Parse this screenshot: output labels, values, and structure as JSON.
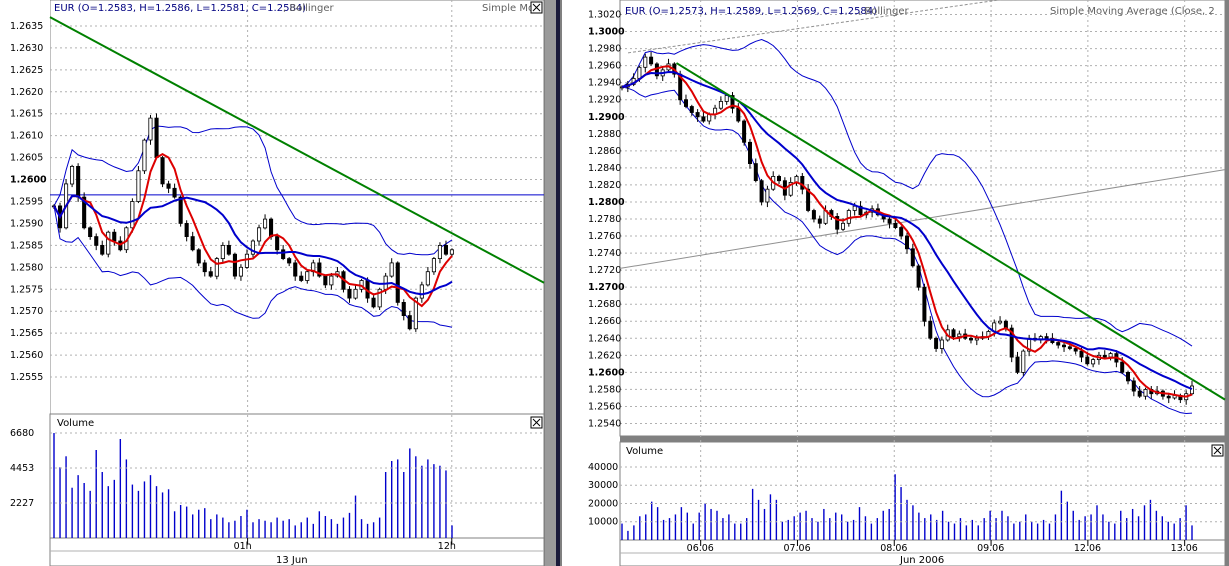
{
  "colors": {
    "candle": "#000000",
    "bollinger": "#0000cc",
    "sma_red": "#dd0000",
    "sma_blue": "#0000cc",
    "trendline": "#008000",
    "volume": "#0000cc",
    "grid": "#b0b0b0",
    "panel_bg": "#ffffff",
    "frame_bg": "#808080"
  },
  "left": {
    "header": "EUR (O=1.2583, H=1.2586, L=1.2581, C=1.2584)",
    "indicator_label": ", Bollinger",
    "right_label": "Simple Mo",
    "volume_label": "Volume",
    "x_ticks": [
      {
        "label": "01h",
        "x": 60
      },
      {
        "label": "12h",
        "x": 122
      }
    ],
    "date_label": "13 Jun"
  },
  "right": {
    "header": "EUR (O=1.2573, H=1.2589, L=1.2569, C=1.2584)",
    "indicator_label": ", Bollinger",
    "right_label": "Simple Moving Average (Close, 2",
    "volume_label": "Volume",
    "x_ticks": [
      {
        "label": "06.06",
        "x": 20
      },
      {
        "label": "07.06",
        "x": 44
      },
      {
        "label": "08.06",
        "x": 68
      },
      {
        "label": "09.06",
        "x": 92
      },
      {
        "label": "12.06",
        "x": 116
      },
      {
        "label": "13.06",
        "x": 140
      }
    ],
    "date_label": "Jun 2006"
  },
  "chart_data": [
    {
      "type": "candlestick",
      "title": "EUR (O=1.2583, H=1.2586, L=1.2581, C=1.2584)",
      "ylim": [
        1.255,
        1.264
      ],
      "y_ticks": [
        "1.2555",
        "1.2560",
        "1.2565",
        "1.2570",
        "1.2575",
        "1.2580",
        "1.2585",
        "1.2590",
        "1.2595",
        "1.2600",
        "1.2605",
        "1.2610",
        "1.2615",
        "1.2620",
        "1.2625",
        "1.2630",
        "1.2635"
      ],
      "bold_ticks": [
        "1.2600"
      ],
      "xlim": [
        0,
        150
      ],
      "horizontal_line": 1.25965,
      "trendline": {
        "x": [
          0,
          150
        ],
        "y": [
          1.2637,
          1.25765
        ]
      },
      "close": [
        1.2594,
        1.2589,
        1.2599,
        1.2603,
        1.2596,
        1.2589,
        1.2587,
        1.2585,
        1.2583,
        1.2588,
        1.2586,
        1.2584,
        1.2589,
        1.2595,
        1.2602,
        1.2609,
        1.2614,
        1.2605,
        1.2599,
        1.2598,
        1.2596,
        1.259,
        1.2587,
        1.2584,
        1.2581,
        1.2579,
        1.2578,
        1.2582,
        1.2585,
        1.2583,
        1.2578,
        1.258,
        1.2583,
        1.2586,
        1.2589,
        1.2591,
        1.2587,
        1.2584,
        1.2582,
        1.2581,
        1.2578,
        1.2577,
        1.2579,
        1.2581,
        1.2578,
        1.2576,
        1.2578,
        1.2579,
        1.2575,
        1.2573,
        1.2575,
        1.2577,
        1.2573,
        1.2571,
        1.2575,
        1.2578,
        1.2581,
        1.2572,
        1.2569,
        1.2566,
        1.2573,
        1.2576,
        1.2579,
        1.2582,
        1.2585,
        1.2583,
        1.2584
      ],
      "volume": {
        "ylim": [
          0,
          7000
        ],
        "y_ticks": [
          "2227",
          "4453",
          "6680"
        ],
        "values": [
          6680,
          4500,
          5200,
          3200,
          4000,
          3500,
          3000,
          5600,
          4200,
          3300,
          3700,
          6300,
          5000,
          3400,
          3000,
          3600,
          4000,
          3300,
          2900,
          3100,
          1700,
          2100,
          2000,
          1500,
          1800,
          1900,
          1200,
          1500,
          1300,
          1000,
          1100,
          1400,
          1800,
          1000,
          1200,
          1100,
          1000,
          1300,
          1100,
          1200,
          800,
          1000,
          1300,
          900,
          1700,
          1400,
          1200,
          900,
          1300,
          1600,
          2700,
          1200,
          900,
          1000,
          1300,
          4200,
          4900,
          5000,
          4200,
          5700,
          5200,
          4600,
          5000,
          4700,
          4600,
          4300,
          800
        ]
      }
    },
    {
      "type": "candlestick",
      "title": "EUR (O=1.2573, H=1.2589, L=1.2569, C=1.2584)",
      "ylim": [
        1.253,
        1.303
      ],
      "y_ticks": [
        "1.2540",
        "1.2560",
        "1.2580",
        "1.2600",
        "1.2620",
        "1.2640",
        "1.2660",
        "1.2680",
        "1.2700",
        "1.2720",
        "1.2740",
        "1.2760",
        "1.2780",
        "1.2800",
        "1.2820",
        "1.2840",
        "1.2860",
        "1.2880",
        "1.2900",
        "1.2920",
        "1.2940",
        "1.2960",
        "1.2980",
        "1.3000",
        "1.3020"
      ],
      "bold_ticks": [
        "1.2600",
        "1.2700",
        "1.2800",
        "1.2900",
        "1.3000"
      ],
      "xlim": [
        0,
        150
      ],
      "trendline": {
        "x": [
          14,
          150
        ],
        "y": [
          1.2963,
          1.2568
        ]
      },
      "channel_upper": {
        "x": [
          2,
          150
        ],
        "y": [
          1.2975,
          1.3075
        ]
      },
      "channel_lower": {
        "x": [
          0,
          150
        ],
        "y": [
          1.2722,
          1.2838
        ]
      },
      "close": [
        1.2935,
        1.2938,
        1.2945,
        1.2958,
        1.297,
        1.2962,
        1.2948,
        1.2955,
        1.2962,
        1.295,
        1.292,
        1.2912,
        1.2905,
        1.29,
        1.2895,
        1.2903,
        1.291,
        1.2918,
        1.2925,
        1.291,
        1.2895,
        1.287,
        1.2845,
        1.2825,
        1.28,
        1.2815,
        1.283,
        1.2825,
        1.2808,
        1.2823,
        1.283,
        1.2815,
        1.279,
        1.278,
        1.2775,
        1.279,
        1.2783,
        1.2768,
        1.2775,
        1.279,
        1.2795,
        1.2785,
        1.2788,
        1.2792,
        1.2785,
        1.278,
        1.2775,
        1.277,
        1.276,
        1.2745,
        1.2725,
        1.27,
        1.266,
        1.264,
        1.2628,
        1.2638,
        1.265,
        1.2642,
        1.2645,
        1.264,
        1.2638,
        1.264,
        1.2642,
        1.2648,
        1.2658,
        1.266,
        1.2652,
        1.2618,
        1.26,
        1.2625,
        1.264,
        1.2638,
        1.2642,
        1.264,
        1.2635,
        1.2632,
        1.263,
        1.2628,
        1.2625,
        1.2618,
        1.261,
        1.2615,
        1.262,
        1.2618,
        1.2622,
        1.2612,
        1.26,
        1.259,
        1.2578,
        1.2572,
        1.258,
        1.2575,
        1.2578,
        1.2572,
        1.257,
        1.2573,
        1.2568,
        1.2575,
        1.2584
      ],
      "volume": {
        "ylim": [
          0,
          46000
        ],
        "y_ticks": [
          "10000",
          "20000",
          "30000",
          "40000"
        ],
        "values": [
          9000,
          5000,
          8000,
          13000,
          14000,
          21000,
          18000,
          11000,
          12000,
          14000,
          18000,
          15000,
          9000,
          15000,
          20000,
          17000,
          16000,
          12000,
          14000,
          9000,
          9000,
          12000,
          28000,
          22000,
          17000,
          25000,
          22000,
          10000,
          11000,
          13000,
          15000,
          16000,
          12000,
          10000,
          17000,
          12000,
          15000,
          14000,
          10000,
          11000,
          18000,
          13000,
          9000,
          12000,
          16000,
          17000,
          36000,
          29000,
          22000,
          19000,
          15000,
          12000,
          14000,
          11000,
          16000,
          10000,
          9000,
          12000,
          8000,
          11000,
          8000,
          12000,
          16000,
          12000,
          16000,
          13000,
          9000,
          10000,
          14000,
          10000,
          9000,
          11000,
          9000,
          14000,
          27000,
          21000,
          16000,
          11000,
          13000,
          14000,
          19000,
          14000,
          10000,
          9000,
          16000,
          12000,
          17000,
          13000,
          19000,
          22000,
          16000,
          13000,
          10000,
          9000,
          12000,
          19000,
          8000
        ]
      }
    }
  ]
}
